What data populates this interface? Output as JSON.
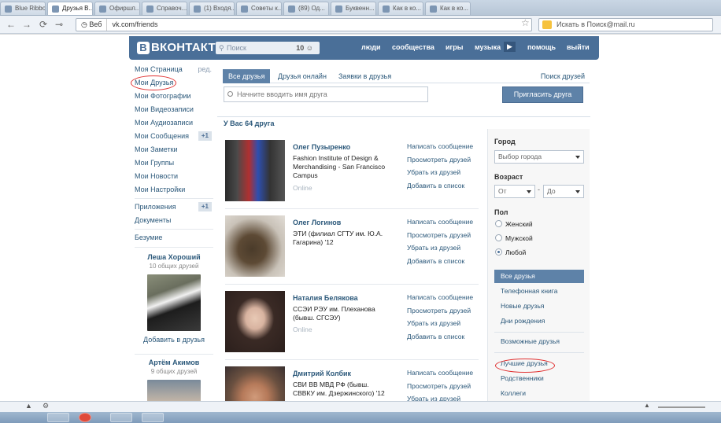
{
  "browser": {
    "tabs": [
      "Blue Ribbon",
      "Друзья В...",
      "Офиршл...",
      "Справоч...",
      "(1) Входя...",
      "Советы к...",
      "(89) Од...",
      "Буквенн...",
      "Как в ко...",
      "Как в ко..."
    ],
    "site_id": "Веб",
    "url": "vk.com/friends",
    "search_placeholder": "Искать в Поиск@mail.ru"
  },
  "vk": {
    "logo": "ВКОНТАКТЕ",
    "logo_letter": "В",
    "search_placeholder": "Поиск",
    "search_count": "10",
    "nav": [
      "люди",
      "сообщества",
      "игры",
      "музыка",
      "помощь",
      "выйти"
    ]
  },
  "left_menu": {
    "items": [
      {
        "label": "Моя Страница",
        "side": "ред."
      },
      {
        "label": "Мои Друзья"
      },
      {
        "label": "Мои Фотографии"
      },
      {
        "label": "Мои Видеозаписи"
      },
      {
        "label": "Мои Аудиозаписи"
      },
      {
        "label": "Мои Сообщения",
        "badge": "+1"
      },
      {
        "label": "Мои Заметки"
      },
      {
        "label": "Мои Группы"
      },
      {
        "label": "Мои Новости"
      },
      {
        "label": "Мои Настройки"
      }
    ],
    "apps": {
      "label": "Приложения",
      "badge": "+1"
    },
    "docs": "Документы",
    "extra": "Безумие",
    "suggested": [
      {
        "name": "Леша Хороший",
        "common": "10 общих друзей",
        "add": "Добавить в друзья"
      },
      {
        "name": "Артём Акимов",
        "common": "9 общих друзей"
      }
    ]
  },
  "tabs": [
    "Все друзья",
    "Друзья онлайн",
    "Заявки в друзья"
  ],
  "find_friends": "Поиск друзей",
  "name_placeholder": "Начните вводить имя друга",
  "invite_label": "Пригласить друга",
  "friends_count": "У Вас 64 друга",
  "actions": [
    "Написать сообщение",
    "Просмотреть друзей",
    "Убрать из друзей",
    "Добавить в список"
  ],
  "friends": [
    {
      "name": "Олег Пузыренко",
      "edu": "Fashion Institute of Design & Merchandising - San Francisco Campus",
      "status": "Online"
    },
    {
      "name": "Олег Логинов",
      "edu": "ЭТИ (филиал СГТУ им. Ю.А. Гагарина) '12",
      "status": ""
    },
    {
      "name": "Наталия Белякова",
      "edu": "ССЭИ РЭУ им. Плеханова (бывш. СГСЭУ)",
      "status": "Online"
    },
    {
      "name": "Дмитрий Колбик",
      "edu": "СВИ ВВ МВД РФ (бывш. СВВКУ им. Дзержинского) '12",
      "status": ""
    }
  ],
  "filters": {
    "city_label": "Город",
    "city_placeholder": "Выбор города",
    "age_label": "Возраст",
    "age_from": "От",
    "age_to": "До",
    "gender_label": "Пол",
    "gender_options": [
      "Женский",
      "Мужской",
      "Любой"
    ],
    "gender_selected": "Любой",
    "lists": [
      "Все друзья",
      "Телефонная книга",
      "Новые друзья",
      "Дни рождения"
    ],
    "lists2": [
      "Возможные друзья"
    ],
    "lists3": [
      "Лучшие друзья",
      "Родственники",
      "Коллеги"
    ]
  }
}
